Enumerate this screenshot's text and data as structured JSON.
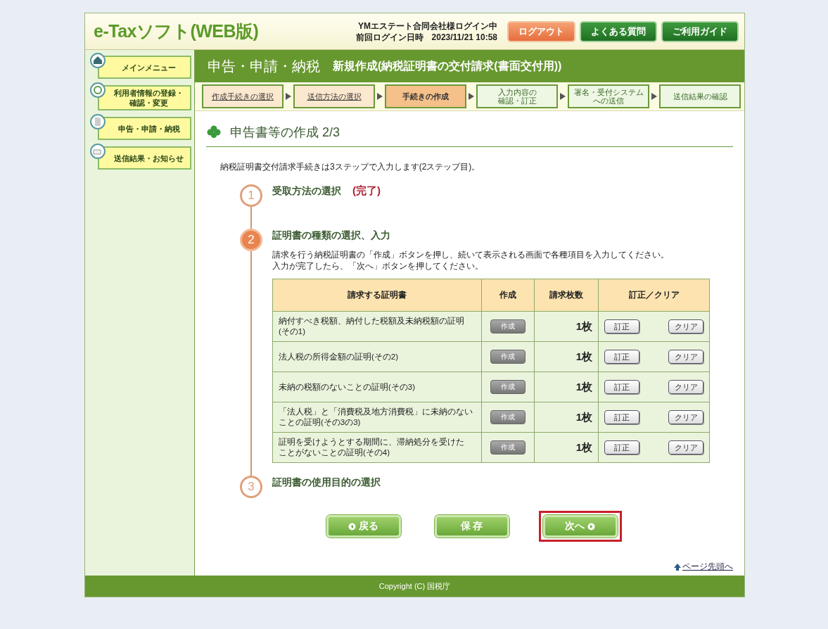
{
  "header": {
    "logo": "e-Taxソフト(WEB版)",
    "user": "YMエステート合同会社様ログイン中",
    "last_login_label": "前回ログイン日時",
    "last_login": "2023/11/21 10:58",
    "buttons": [
      {
        "label": "ログアウト",
        "kind": "logout"
      },
      {
        "label": "よくある質問",
        "kind": "nav"
      },
      {
        "label": "ご利用ガイド",
        "kind": "nav"
      }
    ]
  },
  "sidebar": {
    "items": [
      {
        "lines": [
          "メインメニュー"
        ]
      },
      {
        "lines": [
          "利用者情報の登録・",
          "確認・変更"
        ]
      },
      {
        "lines": [
          "申告・申請・納税"
        ]
      },
      {
        "lines": [
          "送信結果・お知らせ"
        ]
      }
    ]
  },
  "title_bar": {
    "section": "申告・申請・納税",
    "subtitle": "新規作成(納税証明書の交付請求(書面交付用))"
  },
  "progress": [
    {
      "lines": [
        "作成手続きの選択"
      ],
      "done": true,
      "selected": false
    },
    {
      "lines": [
        "送信方法の選択"
      ],
      "done": true,
      "selected": false
    },
    {
      "lines": [
        "手続きの作成"
      ],
      "done": false,
      "selected": true
    },
    {
      "lines": [
        "入力内容の",
        "確認・訂正"
      ],
      "done": false,
      "selected": false
    },
    {
      "lines": [
        "署名・受付システム",
        "への送信"
      ],
      "done": false,
      "selected": false
    },
    {
      "lines": [
        "送信結果の確認"
      ],
      "done": false,
      "selected": false
    }
  ],
  "heading": "申告書等の作成 2/3",
  "intro": "納税証明書交付請求手続きは3ステップで入力します(2ステップ目)。",
  "steps": [
    {
      "number": "1",
      "title": "受取方法の選択",
      "status_text": "(完了)",
      "current": false
    },
    {
      "number": "2",
      "title": "証明書の種類の選択、入力",
      "current": true,
      "instructions": [
        "請求を行う納税証明書の「作成」ボタンを押し、続いて表示される画面で各種項目を入力してください。",
        "入力が完了したら、「次へ」ボタンを押してください。"
      ]
    },
    {
      "number": "3",
      "title": "証明書の使用目的の選択",
      "current": false
    }
  ],
  "table": {
    "columns": [
      "請求する証明書",
      "作成",
      "請求枚数",
      "訂正／クリア"
    ],
    "rows": [
      {
        "certificate": [
          "納付すべき税額、納付した税額及未納税額の証明",
          "(その1)"
        ],
        "create": "作成",
        "count": "1枚",
        "edit": "訂正",
        "clear": "クリア"
      },
      {
        "certificate": [
          "法人税の所得金額の証明(その2)"
        ],
        "create": "作成",
        "count": "1枚",
        "edit": "訂正",
        "clear": "クリア"
      },
      {
        "certificate": [
          "未納の税額のないことの証明(その3)"
        ],
        "create": "作成",
        "count": "1枚",
        "edit": "訂正",
        "clear": "クリア"
      },
      {
        "certificate": [
          "「法人税」と「消費税及地方消費税」に未納のない",
          "ことの証明(その3の3)"
        ],
        "create": "作成",
        "count": "1枚",
        "edit": "訂正",
        "clear": "クリア"
      },
      {
        "certificate": [
          "証明を受けようとする期間に、滞納処分を受けた",
          "ことがないことの証明(その4)"
        ],
        "create": "作成",
        "count": "1枚",
        "edit": "訂正",
        "clear": "クリア"
      }
    ]
  },
  "actions": [
    {
      "label": "戻る",
      "kind": "back",
      "highlighted": false
    },
    {
      "label": "保 存",
      "kind": "save",
      "highlighted": false
    },
    {
      "label": "次へ",
      "kind": "next",
      "highlighted": true
    }
  ],
  "page_top_link": "ページ先頭へ",
  "footer": "Copyright (C) 国税庁"
}
